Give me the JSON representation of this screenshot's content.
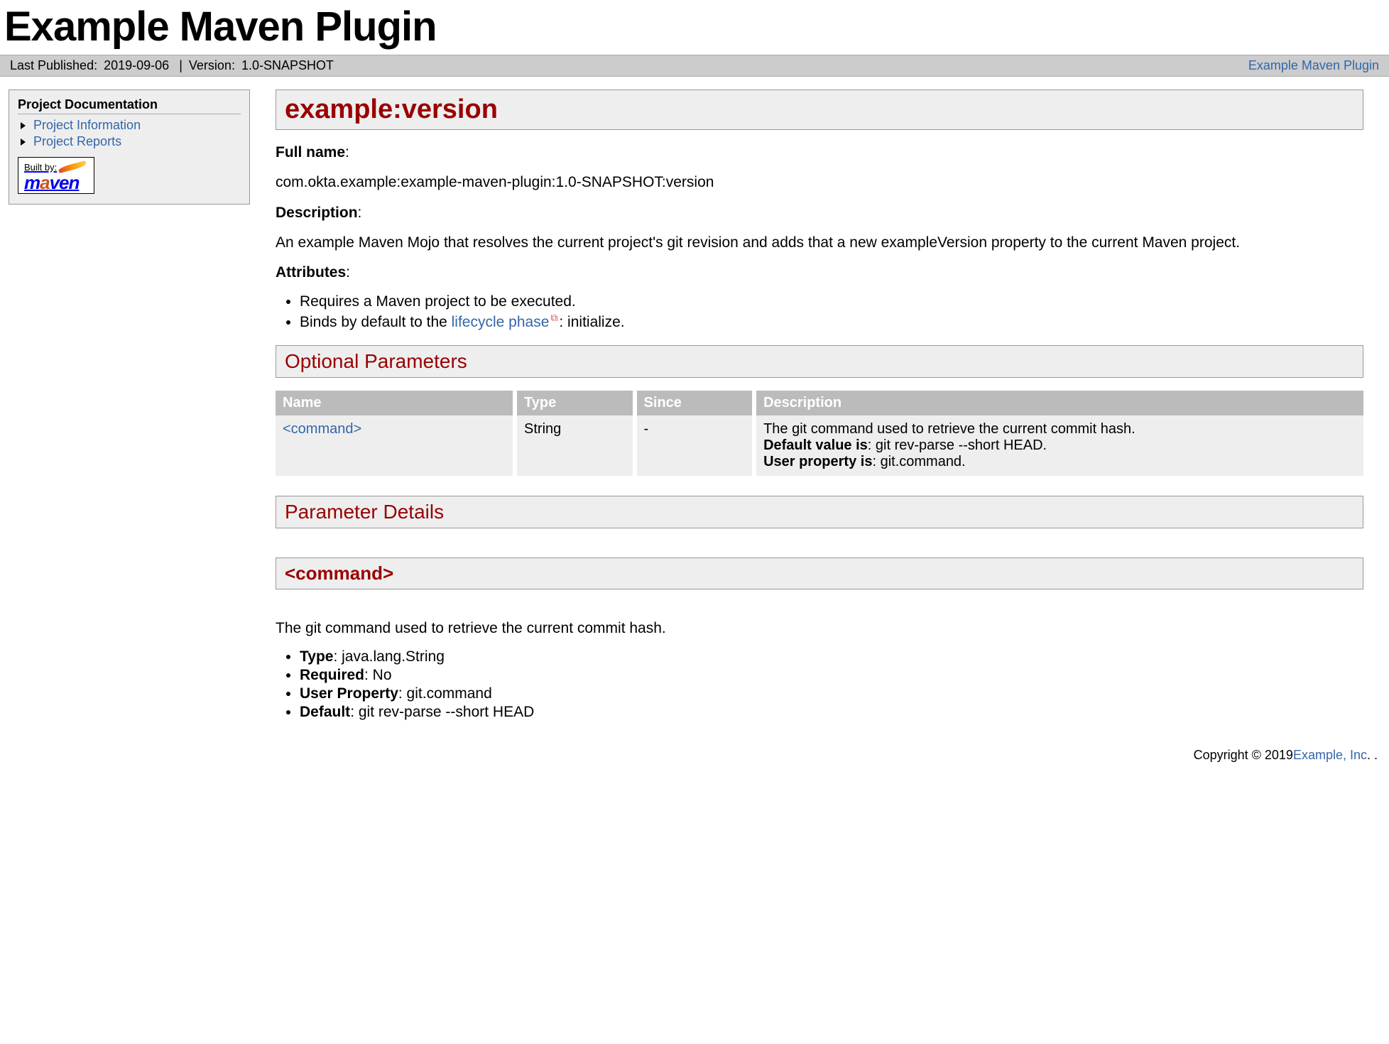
{
  "banner": {
    "title": "Example Maven Plugin"
  },
  "breadcrumb": {
    "last_published_label": "Last Published:",
    "last_published_value": "2019-09-06",
    "version_label": "Version:",
    "version_value": "1.0-SNAPSHOT",
    "right_link": "Example Maven Plugin",
    "sep": "|"
  },
  "sidebar": {
    "heading": "Project Documentation",
    "items": [
      {
        "label": "Project Information"
      },
      {
        "label": "Project Reports"
      }
    ],
    "builtby": "Built by:"
  },
  "content": {
    "goal_heading": "example:version",
    "fullname_label": "Full name",
    "fullname_value": "com.okta.example:example-maven-plugin:1.0-SNAPSHOT:version",
    "description_label": "Description",
    "description_value": "An example Maven Mojo that resolves the current project's git revision and adds that a new exampleVersion property to the current Maven project.",
    "attributes_label": "Attributes",
    "attr1": "Requires a Maven project to be executed.",
    "attr2_prefix": "Binds by default to the ",
    "attr2_link": "lifecycle phase",
    "attr2_suffix": ": initialize.",
    "optional_heading": "Optional Parameters",
    "table": {
      "col_name": "Name",
      "col_type": "Type",
      "col_since": "Since",
      "col_desc": "Description",
      "row_name": "<command>",
      "row_type": "String",
      "row_since": "-",
      "row_desc_line1": "The git command used to retrieve the current commit hash.",
      "row_desc_dv_label": "Default value is",
      "row_desc_dv_value": ": git rev-parse --short HEAD.",
      "row_desc_up_label": "User property is",
      "row_desc_up_value": ": git.command."
    },
    "details_heading": "Parameter Details",
    "param_heading": "<command>",
    "param_desc": "The git command used to retrieve the current commit hash.",
    "detail_type_label": "Type",
    "detail_type_value": ": java.lang.String",
    "detail_req_label": "Required",
    "detail_req_value": ": No",
    "detail_up_label": "User Property",
    "detail_up_value": ": git.command",
    "detail_def_label": "Default",
    "detail_def_value": ": git rev-parse --short HEAD"
  },
  "footer": {
    "prefix": "Copyright © 2019",
    "link": "Example, Inc",
    "suffix": ". ."
  }
}
